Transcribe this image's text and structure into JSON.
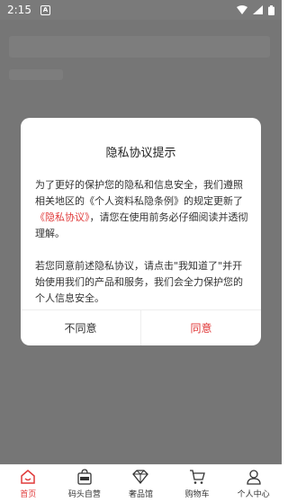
{
  "status": {
    "time": "2:15",
    "notif": "A"
  },
  "dialog": {
    "title": "隐私协议提示",
    "para1_before": "为了更好的保护您的隐私和信息安全，我们遵照相关地区的《个人资料私隐条例》的规定更新了",
    "para1_link": "《隐私协议》",
    "para1_after": "，请您在使用前务必仔细阅读并透彻理解。",
    "para2": "若您同意前述隐私协议，请点击\"我知道了\"并开始使用我们的产品和服务，我们会全力保护您的个人信息安全。",
    "disagree": "不同意",
    "agree": "同意"
  },
  "nav": {
    "home": "首页",
    "wharf": "码头自营",
    "luxury": "奢品馆",
    "cart": "购物车",
    "profile": "个人中心"
  },
  "colors": {
    "accent": "#e03a3a",
    "overlay": "#767676"
  }
}
